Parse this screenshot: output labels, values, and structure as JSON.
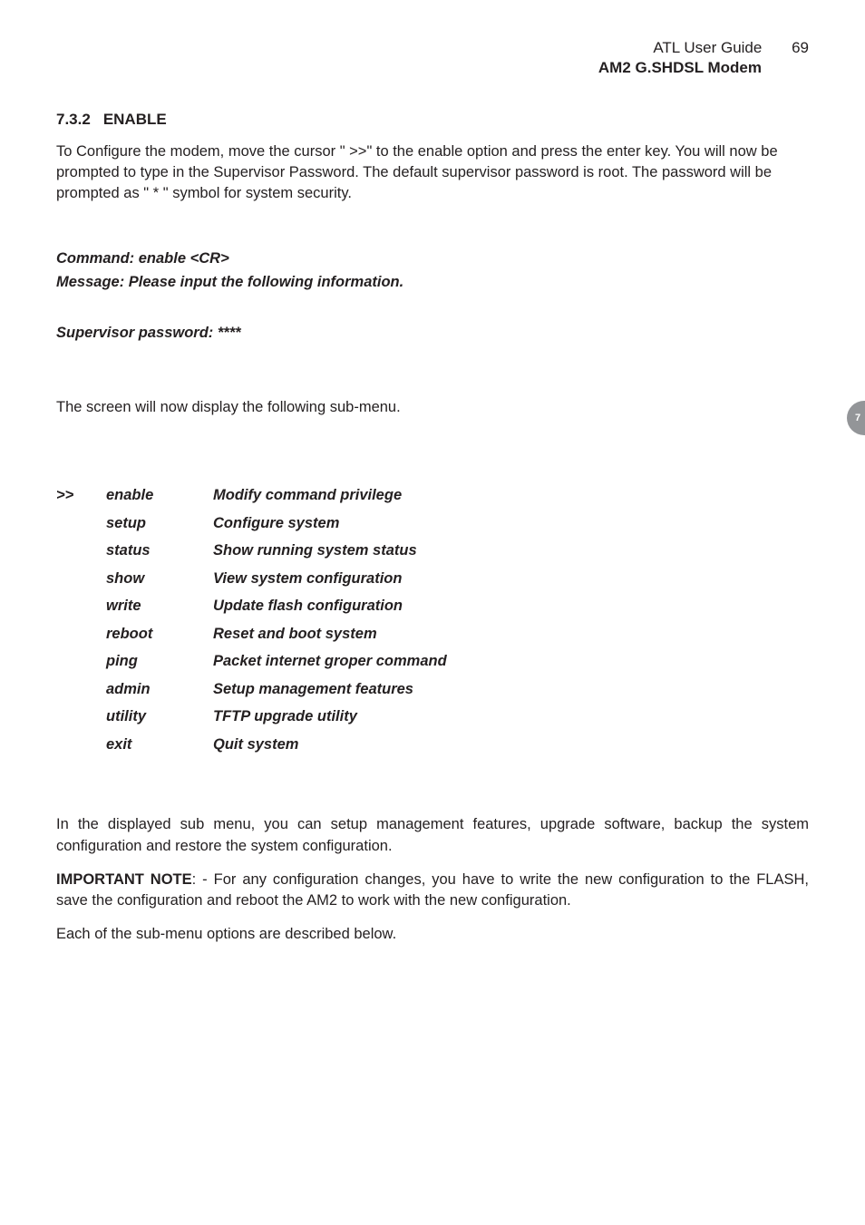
{
  "header": {
    "guide_title": "ATL User Guide",
    "page_number": "69",
    "model": "AM2 G.SHDSL Modem"
  },
  "section": {
    "number": "7.3.2",
    "title": "ENABLE"
  },
  "intro_paragraph": "To Configure the modem, move the cursor \" >>\" to the enable option and press the enter key. You will now be prompted to type in the Supervisor Password. The default supervisor password is root. The password will be prompted as \" * \" symbol for system security.",
  "command_block": {
    "line1": "Command: enable <CR>",
    "line2": "Message: Please input the following information.",
    "line3": "Supervisor password: ****"
  },
  "submenu_intro": "The screen will now display the following sub-menu.",
  "menu": [
    {
      "cursor": ">>",
      "cmd": "enable",
      "desc": "Modify command privilege"
    },
    {
      "cursor": "",
      "cmd": "setup",
      "desc": "Configure system"
    },
    {
      "cursor": "",
      "cmd": "status",
      "desc": "Show running system status"
    },
    {
      "cursor": "",
      "cmd": "show",
      "desc": "View system configuration"
    },
    {
      "cursor": "",
      "cmd": "write",
      "desc": "Update flash configuration"
    },
    {
      "cursor": "",
      "cmd": "reboot",
      "desc": "Reset and boot system"
    },
    {
      "cursor": "",
      "cmd": "ping",
      "desc": "Packet internet groper command"
    },
    {
      "cursor": "",
      "cmd": "admin",
      "desc": "Setup management features"
    },
    {
      "cursor": "",
      "cmd": "utility",
      "desc": "TFTP upgrade utility"
    },
    {
      "cursor": "",
      "cmd": "exit",
      "desc": "Quit system"
    }
  ],
  "after_menu_paragraph": "In the displayed sub menu, you can setup management features, upgrade software, backup the system configuration and restore the system configuration.",
  "important_note_label": "IMPORTANT NOTE",
  "important_note_text": ": - For any configuration changes, you have to write the new configuration to the FLASH, save the configuration and reboot the AM2 to work with the new configuration.",
  "closing_paragraph": "Each of the sub-menu options are described below.",
  "side_tab": "7"
}
